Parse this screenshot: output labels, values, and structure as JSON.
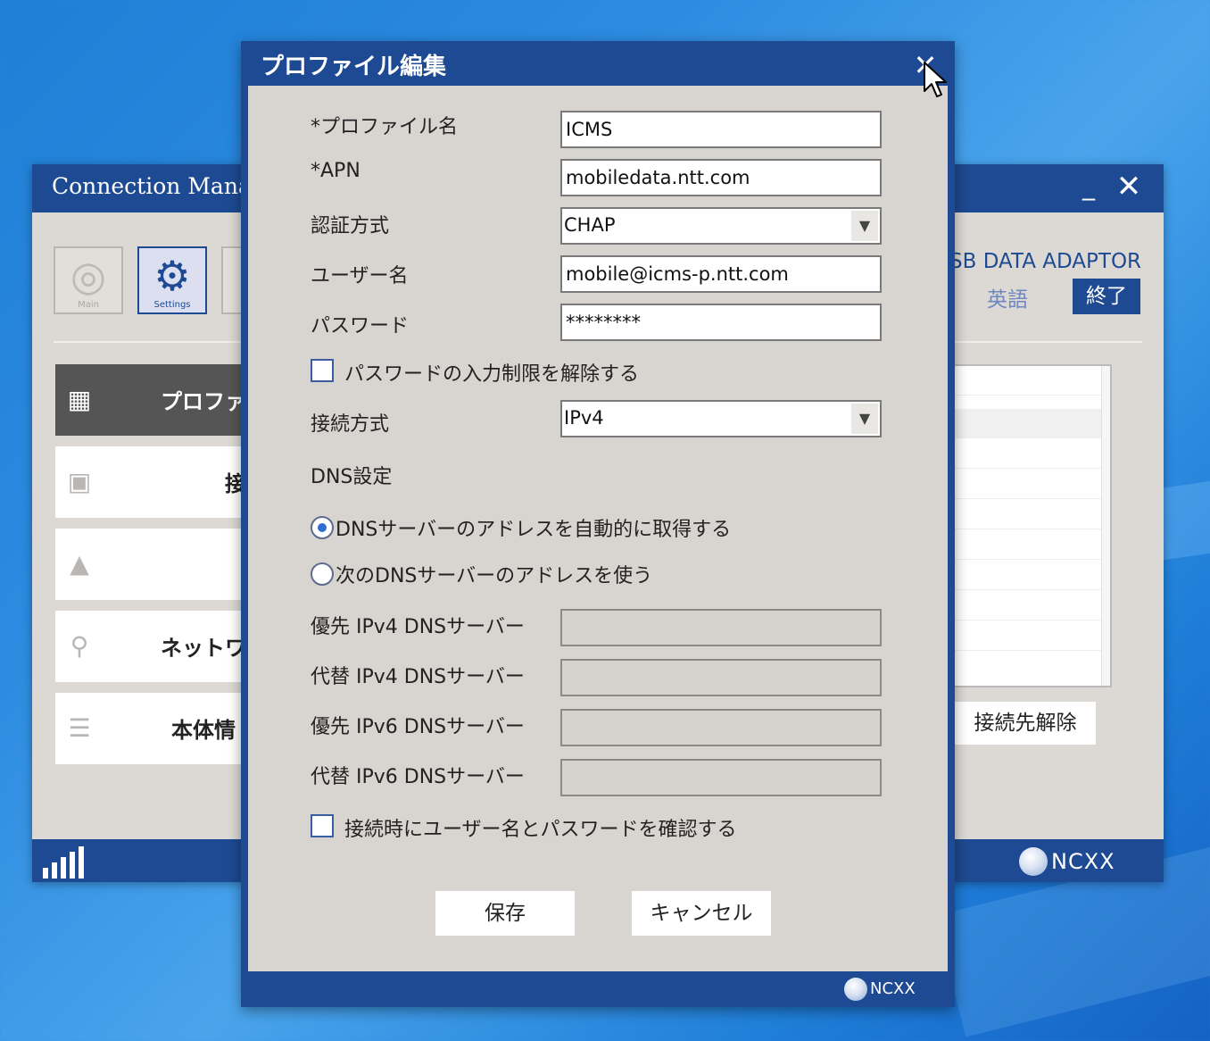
{
  "colors": {
    "brand": "#1d4a92",
    "accent_radio": "#2f6ed1",
    "panel": "#d8d5d1"
  },
  "background_window": {
    "title": "Connection Manag",
    "toolbar": [
      {
        "icon": "globe-icon",
        "label": "Main"
      },
      {
        "icon": "gear-icon",
        "label": "Settings"
      }
    ],
    "menu": [
      {
        "icon": "profile-icon",
        "label": "プロファ"
      },
      {
        "icon": "plug-icon",
        "label": "接"
      },
      {
        "icon": "lock-icon",
        "label": ""
      },
      {
        "icon": "search-icon",
        "label": "ネットワ"
      },
      {
        "icon": "list-icon",
        "label": "本体情"
      }
    ],
    "product": "SB DATA ADAPTOR",
    "language": "英語",
    "exit_label": "終了",
    "disconnect_label": "接続先解除",
    "brand": "NCXX"
  },
  "dialog": {
    "title": "プロファイル編集",
    "profile_name_label": "*プロファイル名",
    "profile_name_value": "ICMS",
    "apn_label": "*APN",
    "apn_value": "mobiledata.ntt.com",
    "auth_label": "認証方式",
    "auth_value": "CHAP",
    "username_label": "ユーザー名",
    "username_value": "mobile@icms-p.ntt.com",
    "password_label": "パスワード",
    "password_value": "********",
    "unlock_password_label": "パスワードの入力制限を解除する",
    "conn_type_label": "接続方式",
    "conn_type_value": "IPv4",
    "dns_section_label": "DNS設定",
    "dns_auto_label": "DNSサーバーのアドレスを自動的に取得する",
    "dns_manual_label": "次のDNSサーバーのアドレスを使う",
    "dns_fields": [
      {
        "label": "優先 IPv4 DNSサーバー",
        "value": ""
      },
      {
        "label": "代替 IPv4 DNSサーバー",
        "value": ""
      },
      {
        "label": "優先 IPv6 DNSサーバー",
        "value": ""
      },
      {
        "label": "代替 IPv6 DNSサーバー",
        "value": ""
      }
    ],
    "confirm_label": "接続時にユーザー名とパスワードを確認する",
    "save_label": "保存",
    "cancel_label": "キャンセル",
    "brand": "NCXX"
  }
}
